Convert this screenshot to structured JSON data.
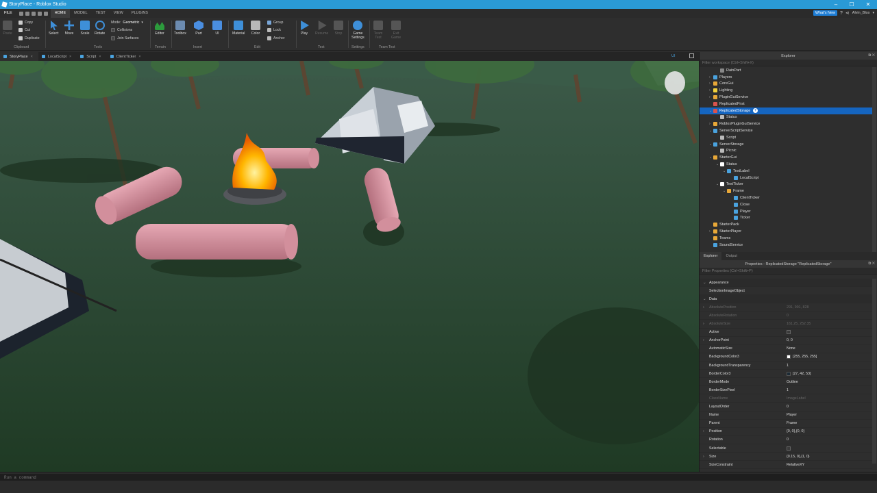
{
  "window": {
    "title": "StoryPlace - Roblox Studio",
    "min": "–",
    "max": "☐",
    "close": "✕"
  },
  "menu": {
    "file": "FILE",
    "tabs": [
      "HOME",
      "MODEL",
      "TEST",
      "VIEW",
      "PLUGINS"
    ],
    "whats_new": "What's New",
    "user": "Alvin_Blox"
  },
  "ribbon": {
    "paste": "Paste",
    "copy": "Copy",
    "cut": "Cut",
    "duplicate": "Duplicate",
    "clipboard": "Clipboard",
    "select": "Select",
    "move": "Move",
    "scale": "Scale",
    "rotate": "Rotate",
    "mode_label": "Mode:",
    "mode_value": "Geometric",
    "collisions": "Collisions",
    "join_surfaces": "Join Surfaces",
    "tools": "Tools",
    "editor": "Editor",
    "terrain": "Terrain",
    "toolbox": "Toolbox",
    "part": "Part",
    "ui": "UI",
    "insert": "Insert",
    "material": "Material",
    "color": "Color",
    "group": "Group",
    "lock": "Lock",
    "anchor": "Anchor",
    "edit": "Edit",
    "play": "Play",
    "resume": "Resume",
    "stop": "Stop",
    "test": "Test",
    "game_settings_1": "Game",
    "game_settings_2": "Settings",
    "settings": "Settings",
    "team_test_1": "Team",
    "team_test_2": "Test",
    "exit_game_1": "Exit",
    "exit_game_2": "Game",
    "team_test": "Team Test"
  },
  "doc_tabs": [
    {
      "label": "StoryPlace"
    },
    {
      "label": "LocalScript"
    },
    {
      "label": "Script"
    },
    {
      "label": "ClientTicker"
    }
  ],
  "viewport": {
    "ui_toggle": "UI"
  },
  "explorer": {
    "title": "Explorer",
    "filter": "Filter workspace (Ctrl+Shift+X)",
    "items": [
      {
        "label": "RainPart",
        "indent": 2,
        "arrow": "",
        "color": "#888888"
      },
      {
        "label": "Players",
        "indent": 1,
        "arrow": "›",
        "color": "#4aa3df"
      },
      {
        "label": "CoreGui",
        "indent": 1,
        "arrow": "›",
        "color": "#e8a838"
      },
      {
        "label": "Lighting",
        "indent": 1,
        "arrow": "›",
        "color": "#f2d03b"
      },
      {
        "label": "PluginGuiService",
        "indent": 1,
        "arrow": "›",
        "color": "#e8a838"
      },
      {
        "label": "ReplicatedFirst",
        "indent": 1,
        "arrow": "",
        "color": "#d9534f"
      },
      {
        "label": "ReplicatedStorage",
        "indent": 1,
        "arrow": "⌄",
        "color": "#d9534f",
        "selected": true
      },
      {
        "label": "Status",
        "indent": 2,
        "arrow": "",
        "color": "#bbbbbb"
      },
      {
        "label": "RobloxPluginGuiService",
        "indent": 1,
        "arrow": "›",
        "color": "#e8a838"
      },
      {
        "label": "ServerScriptService",
        "indent": 1,
        "arrow": "⌄",
        "color": "#4aa3df"
      },
      {
        "label": "Script",
        "indent": 2,
        "arrow": "",
        "color": "#bbbbbb"
      },
      {
        "label": "ServerStorage",
        "indent": 1,
        "arrow": "⌄",
        "color": "#4aa3df"
      },
      {
        "label": "Picnic",
        "indent": 2,
        "arrow": "",
        "color": "#bbbbbb"
      },
      {
        "label": "StarterGui",
        "indent": 1,
        "arrow": "⌄",
        "color": "#e8a838"
      },
      {
        "label": "Status",
        "indent": 2,
        "arrow": "⌄",
        "color": "#ffffff"
      },
      {
        "label": "TextLabel",
        "indent": 3,
        "arrow": "⌄",
        "color": "#4aa3df"
      },
      {
        "label": "LocalScript",
        "indent": 4,
        "arrow": "",
        "color": "#4aa3df"
      },
      {
        "label": "TextTicker",
        "indent": 2,
        "arrow": "⌄",
        "color": "#ffffff"
      },
      {
        "label": "Frame",
        "indent": 3,
        "arrow": "⌄",
        "color": "#e8a838"
      },
      {
        "label": "ClientTicker",
        "indent": 4,
        "arrow": "",
        "color": "#4aa3df"
      },
      {
        "label": "Close",
        "indent": 4,
        "arrow": "",
        "color": "#4aa3df"
      },
      {
        "label": "Player",
        "indent": 4,
        "arrow": "",
        "color": "#4aa3df"
      },
      {
        "label": "Ticker",
        "indent": 4,
        "arrow": "",
        "color": "#4aa3df"
      },
      {
        "label": "StarterPack",
        "indent": 1,
        "arrow": "",
        "color": "#e8a838"
      },
      {
        "label": "StarterPlayer",
        "indent": 1,
        "arrow": "›",
        "color": "#e8a838"
      },
      {
        "label": "Teams",
        "indent": 1,
        "arrow": "",
        "color": "#e8a838"
      },
      {
        "label": "SoundService",
        "indent": 1,
        "arrow": "",
        "color": "#4aa3df"
      }
    ],
    "tabs": [
      "Explorer",
      "Output"
    ]
  },
  "properties": {
    "title": "Properties - ReplicatedStorage \"ReplicatedStorage\"",
    "filter": "Filter Properties (Ctrl+Shift+P)",
    "rows": [
      {
        "type": "cat",
        "name": "Appearance",
        "arrow": "⌄"
      },
      {
        "name": "SelectionImageObject",
        "value": ""
      },
      {
        "type": "cat",
        "name": "Data",
        "arrow": "⌄"
      },
      {
        "name": "AbsolutePosition",
        "value": "291, 991, 828",
        "dim": true,
        "arrow": "›"
      },
      {
        "name": "AbsoluteRotation",
        "value": "0",
        "dim": true
      },
      {
        "name": "AbsoluteSize",
        "value": "161.25, 252.35",
        "dim": true,
        "arrow": "›"
      },
      {
        "name": "Active",
        "value": "",
        "check": true
      },
      {
        "name": "AnchorPoint",
        "value": "0, 0",
        "arrow": "›"
      },
      {
        "name": "AutomaticSize",
        "value": "None"
      },
      {
        "name": "BackgroundColor3",
        "value": "[255, 255, 255]",
        "swatch": "#ffffff"
      },
      {
        "name": "BackgroundTransparency",
        "value": "1"
      },
      {
        "name": "BorderColor3",
        "value": "[27, 42, 53]",
        "swatch": "#1b2a35"
      },
      {
        "name": "BorderMode",
        "value": "Outline"
      },
      {
        "name": "BorderSizePixel",
        "value": "1"
      },
      {
        "name": "ClassName",
        "value": "ImageLabel",
        "dim": true
      },
      {
        "name": "LayoutOrder",
        "value": "0"
      },
      {
        "name": "Name",
        "value": "Player"
      },
      {
        "name": "Parent",
        "value": "Frame"
      },
      {
        "name": "Position",
        "value": "{0, 0},{0, 0}",
        "arrow": "›"
      },
      {
        "name": "Rotation",
        "value": "0"
      },
      {
        "name": "Selectable",
        "value": "",
        "check": true
      },
      {
        "name": "Size",
        "value": "{0.15, 0},{1, 0}",
        "arrow": "›"
      },
      {
        "name": "SizeConstraint",
        "value": "RelativeXY"
      }
    ]
  },
  "command": {
    "placeholder": "Run a command"
  }
}
